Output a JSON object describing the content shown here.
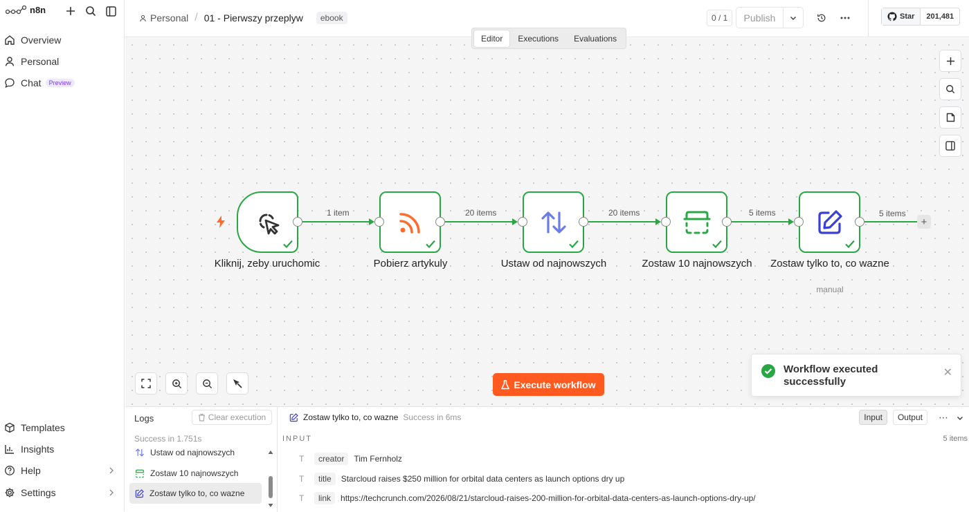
{
  "app": {
    "name": "n8n"
  },
  "sidebar": {
    "nav": [
      {
        "label": "Overview",
        "icon": "home-icon"
      },
      {
        "label": "Personal",
        "icon": "user-icon"
      },
      {
        "label": "Chat",
        "icon": "chat-icon",
        "badge": "Preview"
      }
    ],
    "bottom": [
      {
        "label": "Templates",
        "icon": "box-icon"
      },
      {
        "label": "Insights",
        "icon": "chart-icon"
      },
      {
        "label": "Help",
        "icon": "help-icon"
      },
      {
        "label": "Settings",
        "icon": "gear-icon"
      }
    ]
  },
  "header": {
    "project": "Personal",
    "workflow_name": "01 - Pierwszy przeplyw",
    "tag": "ebook",
    "counter": "0 / 1",
    "publish_label": "Publish",
    "github_star": "Star",
    "github_count": "201,481"
  },
  "canvas": {
    "tabs": [
      "Editor",
      "Executions",
      "Evaluations"
    ],
    "active_tab": "Editor",
    "nodes": [
      {
        "label": "Kliknij, zeby uruchomic",
        "icon": "cursor-click-icon",
        "status": "success"
      },
      {
        "label": "Pobierz artykuly",
        "icon": "rss-icon",
        "status": "success"
      },
      {
        "label": "Ustaw od najnowszych",
        "icon": "sort-arrows-icon",
        "status": "success"
      },
      {
        "label": "Zostaw 10 najnowszych",
        "icon": "limit-icon",
        "status": "success"
      },
      {
        "label": "Zostaw tylko to, co wazne",
        "sublabel": "manual",
        "icon": "edit-icon",
        "status": "success"
      }
    ],
    "edges": [
      "1 item",
      "20 items",
      "20 items",
      "5 items",
      "5 items"
    ],
    "execute_label": "Execute workflow",
    "toast_message": "Workflow executed successfully",
    "colors": {
      "success": "#29a745",
      "accent": "#ff5a1f"
    }
  },
  "logs": {
    "title": "Logs",
    "clear_label": "Clear execution",
    "status": "Success in 1.751s",
    "items": [
      {
        "label": "Ustaw od najnowszych",
        "icon": "sort-arrows-icon"
      },
      {
        "label": "Zostaw 10 najnowszych",
        "icon": "limit-icon"
      },
      {
        "label": "Zostaw tylko to, co wazne",
        "icon": "edit-icon",
        "selected": true
      }
    ],
    "detail": {
      "node": "Zostaw tylko to, co wazne",
      "status": "Success in 6ms",
      "input_label": "Input",
      "output_label": "Output",
      "section": "INPUT",
      "items_count": "5 items",
      "fields": [
        {
          "key": "creator",
          "value": "Tim Fernholz"
        },
        {
          "key": "title",
          "value": "Starcloud raises $250 million for orbital data centers as launch options dry up"
        },
        {
          "key": "link",
          "value": "https://techcrunch.com/2026/08/21/starcloud-raises-200-million-for-orbital-data-centers-as-launch-options-dry-up/"
        }
      ]
    }
  }
}
